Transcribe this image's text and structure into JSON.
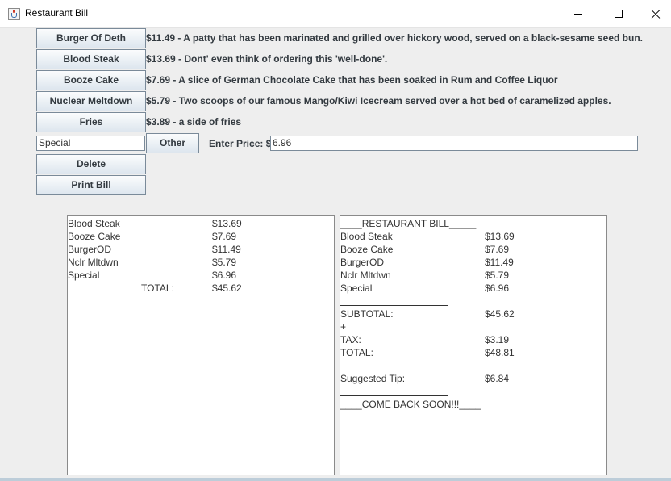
{
  "window": {
    "title": "Restaurant Bill"
  },
  "menu": [
    {
      "label": "Burger Of Deth",
      "description": "$11.49 - A patty that has been marinated and grilled over hickory wood, served on a black-sesame seed bun."
    },
    {
      "label": "Blood Steak",
      "description": "$13.69 - Dont' even think of ordering this 'well-done'."
    },
    {
      "label": "Booze Cake",
      "description": "$7.69 - A slice of German Chocolate Cake that has been soaked  in Rum and Coffee Liquor"
    },
    {
      "label": "Nuclear Meltdown",
      "description": "$5.79 - Two scoops of our famous Mango/Kiwi Icecream  served over a hot bed of caramelized apples."
    },
    {
      "label": "Fries",
      "description": "$3.89 - a side of fries"
    }
  ],
  "custom": {
    "name_value": "Special",
    "other_label": "Other",
    "price_label": "Enter Price: $",
    "price_value": "6.96"
  },
  "actions": {
    "delete_label": "Delete",
    "print_label": "Print Bill"
  },
  "order_list": {
    "items": [
      {
        "name": "Blood Steak",
        "price": "$13.69"
      },
      {
        "name": "Booze Cake",
        "price": "$7.69"
      },
      {
        "name": "BurgerOD",
        "price": "$11.49"
      },
      {
        "name": "Nclr Mltdwn",
        "price": "$5.79"
      },
      {
        "name": "Special",
        "price": "$6.96"
      }
    ],
    "total_label": "TOTAL:",
    "total_value": "$45.62"
  },
  "bill": {
    "header": "____RESTAURANT BILL_____",
    "items": [
      {
        "name": "Blood Steak",
        "price": "$13.69"
      },
      {
        "name": "Booze Cake",
        "price": "$7.69"
      },
      {
        "name": "BurgerOD",
        "price": "$11.49"
      },
      {
        "name": "Nclr Mltdwn",
        "price": "$5.79"
      },
      {
        "name": "Special",
        "price": "$6.96"
      }
    ],
    "subtotal_label": " SUBTOTAL:",
    "subtotal_value": "$45.62",
    "plus": "+",
    "tax_label": "TAX:",
    "tax_value": "$3.19",
    "total_label": "TOTAL:",
    "total_value": "$48.81",
    "tip_label": "Suggested Tip:",
    "tip_value": "$6.84",
    "footer": "____COME BACK SOON!!!____"
  }
}
